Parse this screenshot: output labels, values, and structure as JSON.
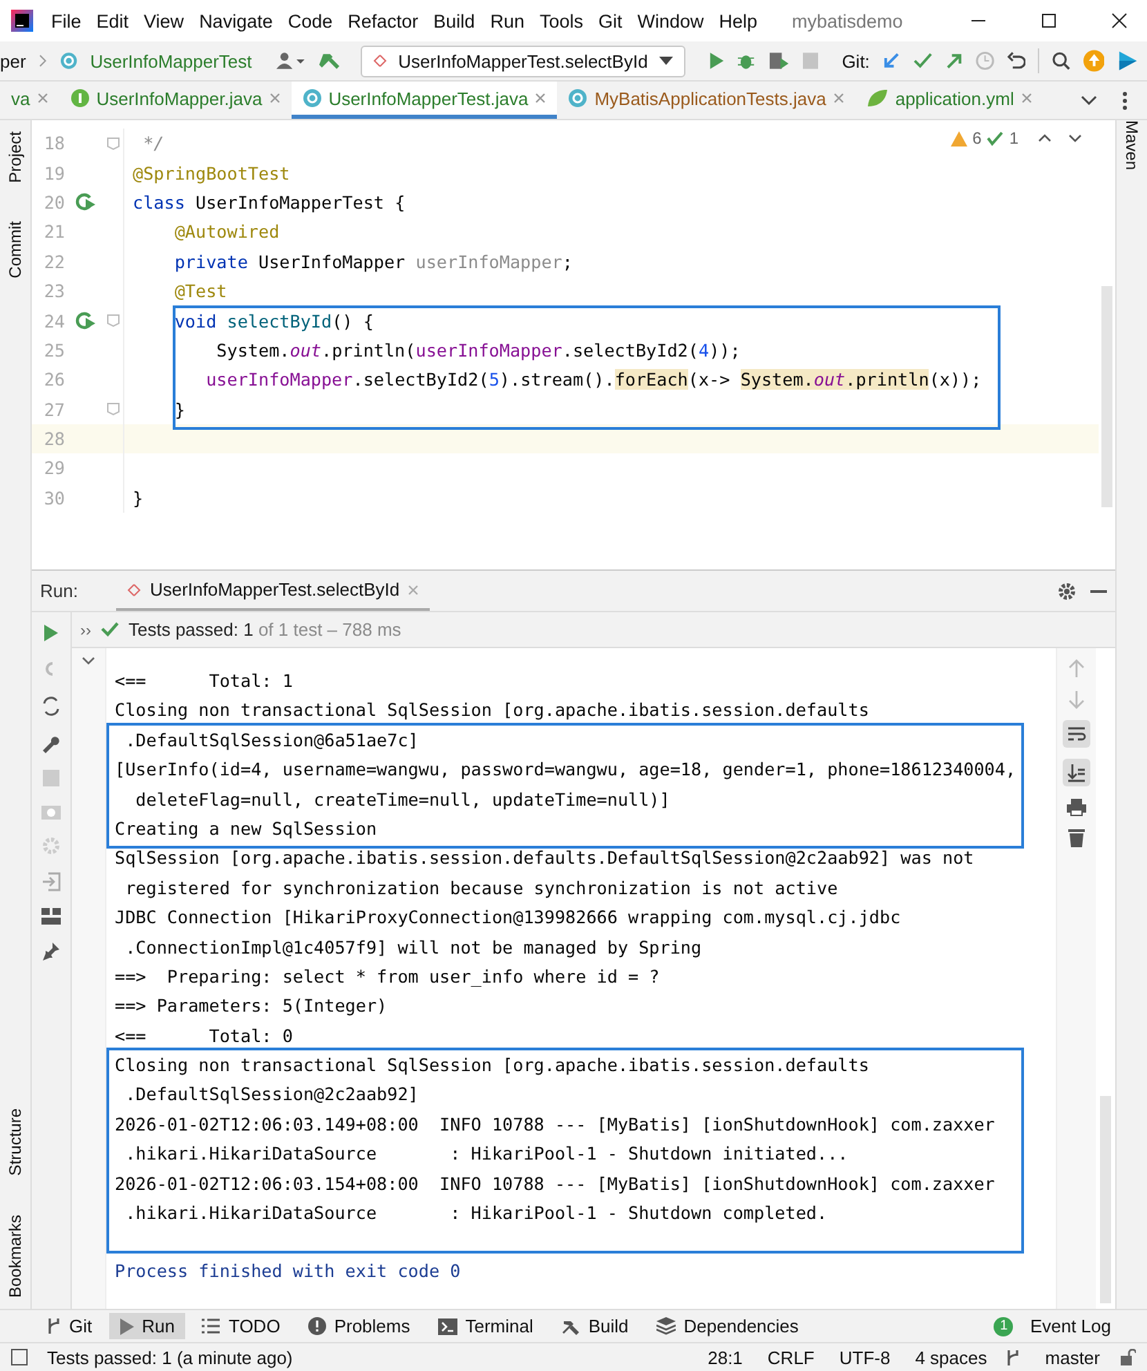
{
  "title_bar": {
    "menu": [
      "File",
      "Edit",
      "View",
      "Navigate",
      "Code",
      "Refactor",
      "Build",
      "Run",
      "Tools",
      "Git",
      "Window",
      "Help"
    ],
    "project": "mybatisdemo"
  },
  "nav_bar": {
    "breadcrumbs": [
      "per",
      "UserInfoMapperTest"
    ],
    "run_config": "UserInfoMapperTest.selectById",
    "git_label": "Git:"
  },
  "tabs": [
    {
      "label": "va",
      "kind": "none",
      "color": "#2b7d2b",
      "selected": false
    },
    {
      "label": "UserInfoMapper.java",
      "kind": "interface",
      "color": "#2b7d2b",
      "selected": false
    },
    {
      "label": "UserInfoMapperTest.java",
      "kind": "class",
      "color": "#2b7d2b",
      "selected": true
    },
    {
      "label": "MyBatisApplicationTests.java",
      "kind": "class",
      "color": "#9a5a1c",
      "selected": false
    },
    {
      "label": "application.yml",
      "kind": "leaf",
      "color": "#2b7d2b",
      "selected": false
    }
  ],
  "side_tools": {
    "left_top": [
      "Project",
      "Commit"
    ],
    "left_bottom": [
      "Structure",
      "Bookmarks"
    ],
    "right": [
      "Maven"
    ]
  },
  "editor": {
    "warnings": "6",
    "checks": "1",
    "lines": [
      {
        "number": "18",
        "run": false,
        "fold": true,
        "current": false,
        "boxed": false,
        "tokens": [
          {
            "text": " */",
            "kind": "comment"
          }
        ]
      },
      {
        "number": "19",
        "run": false,
        "fold": false,
        "current": false,
        "boxed": false,
        "tokens": [
          {
            "text": "@SpringBootTest",
            "kind": "annotation"
          }
        ]
      },
      {
        "number": "20",
        "run": true,
        "fold": false,
        "current": false,
        "boxed": false,
        "tokens": [
          {
            "text": "class",
            "kind": "keyword"
          },
          {
            "text": " UserInfoMapperTest {",
            "kind": "plain"
          }
        ]
      },
      {
        "number": "21",
        "run": false,
        "fold": false,
        "current": false,
        "boxed": false,
        "tokens": [
          {
            "text": "    @Autowired",
            "kind": "annotation"
          }
        ]
      },
      {
        "number": "22",
        "run": false,
        "fold": false,
        "current": false,
        "boxed": false,
        "tokens": [
          {
            "text": "    private",
            "kind": "keyword"
          },
          {
            "text": " UserInfoMapper ",
            "kind": "plain"
          },
          {
            "text": "userInfoMapper",
            "kind": "unused"
          },
          {
            "text": ";",
            "kind": "plain"
          }
        ]
      },
      {
        "number": "23",
        "run": false,
        "fold": false,
        "current": false,
        "boxed": false,
        "tokens": [
          {
            "text": "    @Test",
            "kind": "annotation"
          }
        ]
      },
      {
        "number": "24",
        "run": true,
        "fold": true,
        "current": false,
        "boxed": true,
        "tokens": [
          {
            "text": "    void",
            "kind": "keyword"
          },
          {
            "text": " selectById",
            "kind": "decl"
          },
          {
            "text": "() {",
            "kind": "plain"
          }
        ]
      },
      {
        "number": "25",
        "run": false,
        "fold": false,
        "current": false,
        "boxed": true,
        "tokens": [
          {
            "text": "        System.",
            "kind": "plain"
          },
          {
            "text": "out",
            "kind": "static"
          },
          {
            "text": ".println(",
            "kind": "plain"
          },
          {
            "text": "userInfoMapper",
            "kind": "field"
          },
          {
            "text": ".selectById2(",
            "kind": "plain"
          },
          {
            "text": "4",
            "kind": "number"
          },
          {
            "text": "));",
            "kind": "plain"
          }
        ]
      },
      {
        "number": "26",
        "run": false,
        "fold": false,
        "current": false,
        "boxed": true,
        "tokens": [
          {
            "text": "       userInfoMapper",
            "kind": "field"
          },
          {
            "text": ".selectById2(",
            "kind": "plain"
          },
          {
            "text": "5",
            "kind": "number"
          },
          {
            "text": ").stream().",
            "kind": "plain"
          },
          {
            "text": "forEach",
            "kind": "usage"
          },
          {
            "text": "(x-> ",
            "kind": "plain"
          },
          {
            "text": "System.",
            "kind": "usage"
          },
          {
            "text": "out",
            "kind": "usage-static"
          },
          {
            "text": ".println",
            "kind": "usage"
          },
          {
            "text": "(x));",
            "kind": "plain"
          }
        ]
      },
      {
        "number": "27",
        "run": false,
        "fold": true,
        "current": false,
        "boxed": true,
        "tokens": [
          {
            "text": "    }",
            "kind": "plain"
          }
        ]
      },
      {
        "number": "28",
        "run": false,
        "fold": false,
        "current": true,
        "boxed": false
      },
      {
        "number": "29",
        "run": false,
        "fold": false,
        "current": false,
        "boxed": false
      },
      {
        "number": "30",
        "run": false,
        "fold": false,
        "current": false,
        "boxed": false,
        "tokens": [
          {
            "text": "}",
            "kind": "plain"
          }
        ]
      }
    ]
  },
  "run_panel": {
    "label": "Run:",
    "tab": "UserInfoMapperTest.selectById",
    "expand": "››",
    "result": "Tests passed: 1",
    "result_detail": " of 1 test – 788 ms",
    "console": [
      {
        "text": "<==      Total: 1",
        "kind": "plain",
        "boxed": false
      },
      {
        "text": "Closing non transactional SqlSession [org.apache.ibatis.session.defaults",
        "kind": "plain",
        "boxed": false
      },
      {
        "text": " .DefaultSqlSession@6a51ae7c]",
        "kind": "plain",
        "boxed": true
      },
      {
        "text": "[UserInfo(id=4, username=wangwu, password=wangwu, age=18, gender=1, phone=18612340004,",
        "kind": "plain",
        "boxed": true
      },
      {
        "text": "  deleteFlag=null, createTime=null, updateTime=null)]",
        "kind": "plain",
        "boxed": true
      },
      {
        "text": "Creating a new SqlSession",
        "kind": "plain",
        "boxed": true
      },
      {
        "text": "SqlSession [org.apache.ibatis.session.defaults.DefaultSqlSession@2c2aab92] was not",
        "kind": "plain",
        "boxed": false
      },
      {
        "text": " registered for synchronization because synchronization is not active",
        "kind": "plain",
        "boxed": false
      },
      {
        "text": "JDBC Connection [HikariProxyConnection@139982666 wrapping com.mysql.cj.jdbc",
        "kind": "plain",
        "boxed": false
      },
      {
        "text": " .ConnectionImpl@1c4057f9] will not be managed by Spring",
        "kind": "plain",
        "boxed": false
      },
      {
        "text": "==>  Preparing: select * from user_info where id = ?",
        "kind": "plain",
        "boxed": false
      },
      {
        "text": "==> Parameters: 5(Integer)",
        "kind": "plain",
        "boxed": false
      },
      {
        "text": "<==      Total: 0",
        "kind": "plain",
        "boxed": false
      },
      {
        "text": "Closing non transactional SqlSession [org.apache.ibatis.session.defaults",
        "kind": "plain",
        "boxed": true
      },
      {
        "text": " .DefaultSqlSession@2c2aab92]",
        "kind": "plain",
        "boxed": true
      },
      {
        "text": "2026-01-02T12:06:03.149+08:00  INFO 10788 --- [MyBatis] [ionShutdownHook] com.zaxxer",
        "kind": "plain",
        "boxed": true
      },
      {
        "text": " .hikari.HikariDataSource       : HikariPool-1 - Shutdown initiated...",
        "kind": "plain",
        "boxed": true
      },
      {
        "text": "2026-01-02T12:06:03.154+08:00  INFO 10788 --- [MyBatis] [ionShutdownHook] com.zaxxer",
        "kind": "plain",
        "boxed": true
      },
      {
        "text": " .hikari.HikariDataSource       : HikariPool-1 - Shutdown completed.",
        "kind": "plain",
        "boxed": true
      },
      {
        "text": "Process finished with exit code 0",
        "kind": "exit",
        "boxed": false
      }
    ]
  },
  "tool_bar": {
    "items": [
      {
        "label": "Git",
        "kind": "branch",
        "selected": false
      },
      {
        "label": "Run",
        "kind": "play",
        "selected": true
      },
      {
        "label": "TODO",
        "kind": "list",
        "selected": false
      },
      {
        "label": "Problems",
        "kind": "alert",
        "selected": false
      },
      {
        "label": "Terminal",
        "kind": "terminal",
        "selected": false
      },
      {
        "label": "Build",
        "kind": "hammer",
        "selected": false
      },
      {
        "label": "Dependencies",
        "kind": "layers",
        "selected": false
      }
    ],
    "event_log": "Event Log",
    "event_count": "1"
  },
  "status_bar": {
    "message": "Tests passed: 1 (a minute ago)",
    "items": [
      "28:1",
      "CRLF",
      "UTF-8",
      "4 spaces"
    ],
    "branch": "master"
  }
}
